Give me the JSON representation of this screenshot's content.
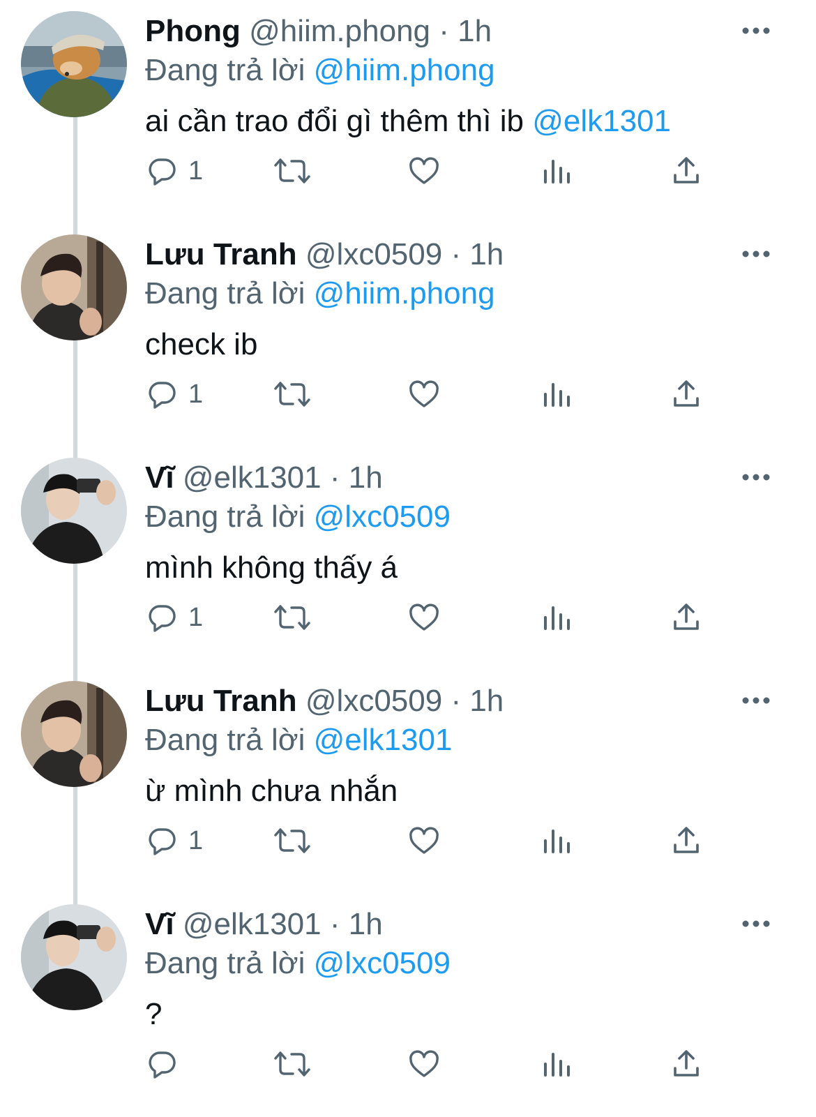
{
  "tweets": [
    {
      "display_name": "Phong",
      "handle": "@hiim.phong",
      "dot": "·",
      "time": "1h",
      "replying_prefix": "Đang trả lời",
      "replying_to": "@hiim.phong",
      "text": "ai cần trao đổi gì thêm thì ib ",
      "text_mention": "@elk1301",
      "reply_count": "1",
      "avatar": "dog-in-hat-avatar"
    },
    {
      "display_name": "Lưu Tranh",
      "handle": "@lxc0509",
      "dot": "·",
      "time": "1h",
      "replying_prefix": "Đang trả lời",
      "replying_to": "@hiim.phong",
      "text": "check ib",
      "text_mention": "",
      "reply_count": "1",
      "avatar": "man-portrait-avatar"
    },
    {
      "display_name": "Vĩ",
      "handle": "@elk1301",
      "dot": "·",
      "time": "1h",
      "replying_prefix": "Đang trả lời",
      "replying_to": "@lxc0509",
      "text": "mình không thấy á",
      "text_mention": "",
      "reply_count": "1",
      "avatar": "mirror-selfie-avatar"
    },
    {
      "display_name": "Lưu Tranh",
      "handle": "@lxc0509",
      "dot": "·",
      "time": "1h",
      "replying_prefix": "Đang trả lời",
      "replying_to": "@elk1301",
      "text": "ừ mình chưa nhắn",
      "text_mention": "",
      "reply_count": "1",
      "avatar": "man-portrait-avatar"
    },
    {
      "display_name": "Vĩ",
      "handle": "@elk1301",
      "dot": "·",
      "time": "1h",
      "replying_prefix": "Đang trả lời",
      "replying_to": "@lxc0509",
      "text": "?",
      "text_mention": "",
      "reply_count": "",
      "avatar": "mirror-selfie-avatar"
    }
  ],
  "icons": {
    "reply": "reply-icon",
    "retweet": "retweet-icon",
    "like": "like-icon",
    "views": "views-icon",
    "share": "share-icon",
    "more": "more-icon"
  },
  "colors": {
    "mention": "#1d9bf0",
    "secondary_text": "#536471",
    "thread_line": "#cfd9de"
  }
}
